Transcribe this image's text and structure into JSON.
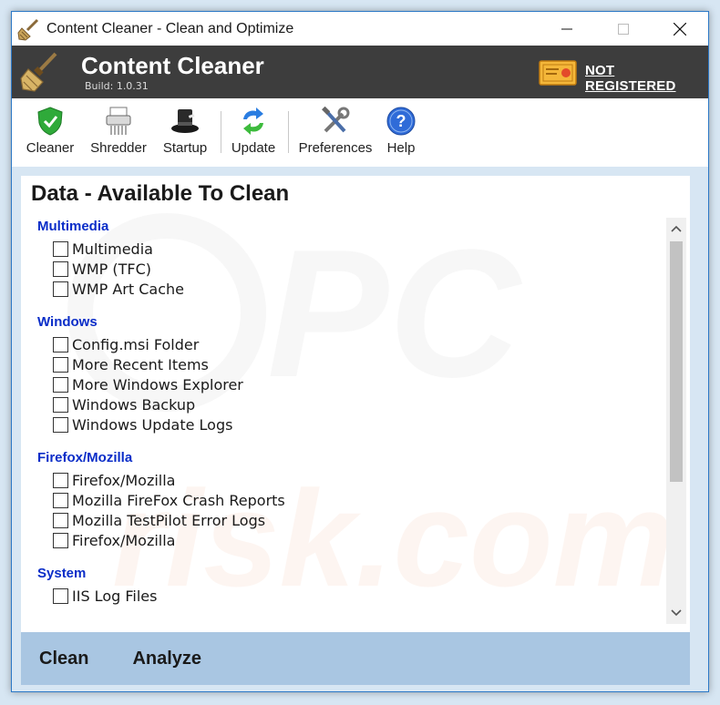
{
  "window": {
    "title": "Content Cleaner - Clean and Optimize"
  },
  "header": {
    "brand_name": "Content Cleaner",
    "build": "Build: 1.0.31",
    "registration_link": "NOT REGISTERED"
  },
  "toolbar": {
    "cleaner": "Cleaner",
    "shredder": "Shredder",
    "startup": "Startup",
    "update": "Update",
    "preferences": "Preferences",
    "help": "Help"
  },
  "panel": {
    "title": "Data - Available To Clean",
    "groups": [
      {
        "title": "Multimedia",
        "items": [
          "Multimedia",
          "WMP (TFC)",
          "WMP Art Cache"
        ]
      },
      {
        "title": "Windows",
        "items": [
          "Config.msi Folder",
          "More Recent Items",
          "More Windows Explorer",
          "Windows Backup",
          "Windows Update Logs"
        ]
      },
      {
        "title": "Firefox/Mozilla",
        "items": [
          "Firefox/Mozilla",
          "Mozilla FireFox Crash Reports",
          "Mozilla TestPilot Error Logs",
          "Firefox/Mozilla"
        ]
      },
      {
        "title": "System",
        "items": [
          "IIS Log Files"
        ]
      }
    ]
  },
  "actions": {
    "clean": "Clean",
    "analyze": "Analyze"
  },
  "colors": {
    "header_bg": "#3d3d3d",
    "group_title": "#0a2dc8",
    "action_bar": "#a9c6e2",
    "frame": "#d7e6f3"
  }
}
